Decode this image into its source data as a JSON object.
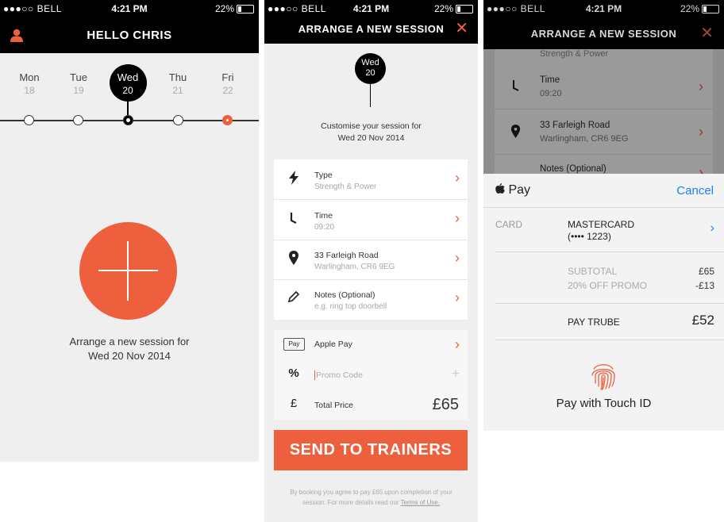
{
  "status_bar": {
    "carrier": "●●●○○ BELL",
    "time": "4:21 PM",
    "battery": "22%"
  },
  "screen1": {
    "title": "HELLO CHRIS",
    "dates": [
      {
        "day": "Mon",
        "num": "18"
      },
      {
        "day": "Tue",
        "num": "19"
      },
      {
        "day": "Wed",
        "num": "20"
      },
      {
        "day": "Thu",
        "num": "21"
      },
      {
        "day": "Fri",
        "num": "22"
      }
    ],
    "arrange_line1": "Arrange a new session for",
    "arrange_line2": "Wed 20 Nov 2014"
  },
  "screen2": {
    "title": "ARRANGE A NEW SESSION",
    "pin_day": "Wed",
    "pin_num": "20",
    "customise_line1": "Customise your session for",
    "customise_line2": "Wed 20 Nov 2014",
    "details": [
      {
        "label": "Type",
        "value": "Strength & Power",
        "icon": "bolt-icon"
      },
      {
        "label": "Time",
        "value": "09:20",
        "icon": "clock-icon"
      },
      {
        "label": "33 Farleigh Road",
        "value": "Warlingham, CR6 9EG",
        "icon": "location-pin-icon"
      },
      {
        "label": "Notes (Optional)",
        "value": "e.g. ring top doorbell",
        "icon": "pencil-icon"
      }
    ],
    "payment_method": "Apple Pay",
    "payment_badge": "Pay",
    "promo_placeholder": "Promo Code",
    "total_label": "Total Price",
    "total_value": "£65",
    "send_button": "SEND TO TRAINERS",
    "terms_text": "By booking you agree to pay £65 upon completion of your session. For more details read our",
    "terms_link": "Terms of Use."
  },
  "screen3": {
    "title": "ARRANGE A NEW SESSION",
    "partial_top": "Strength & Power",
    "rows": [
      {
        "label": "Time",
        "value": "09:20"
      },
      {
        "label": "33 Farleigh Road",
        "value": "Warlingham, CR6 9EG"
      },
      {
        "label": "Notes (Optional)",
        "value": ""
      }
    ],
    "applepay": {
      "logo_text": "Pay",
      "cancel": "Cancel",
      "card_label": "CARD",
      "card_name": "MASTERCARD",
      "card_number": "(•••• 1223)",
      "subtotal_label": "SUBTOTAL",
      "subtotal_value": "£65",
      "promo_label": "20% OFF PROMO",
      "promo_value": "-£13",
      "pay_label": "PAY TRUBE",
      "pay_value": "£52",
      "touch_id_text": "Pay with Touch ID"
    }
  },
  "colors": {
    "accent": "#ee5f3d",
    "ios_blue": "#1c7ef8",
    "bar": "#000000",
    "background": "#efeff0"
  }
}
